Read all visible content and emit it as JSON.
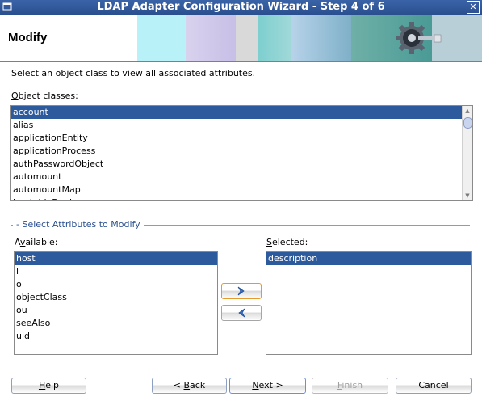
{
  "window": {
    "title": "LDAP Adapter Configuration Wizard - Step 4 of 6",
    "system_icon": "window-menu-icon",
    "close_icon": "close-icon",
    "close_glyph": "✕"
  },
  "header": {
    "title": "Modify",
    "banner_icon": "gear-plug-icon"
  },
  "instruction": "Select an object class to view all associated attributes.",
  "object_classes": {
    "label": "Object classes:",
    "items": [
      "account",
      "alias",
      "applicationEntity",
      "applicationProcess",
      "authPasswordObject",
      "automount",
      "automountMap",
      "bootableDevice"
    ],
    "selected": "account"
  },
  "attributes_group": {
    "title": "Select Attributes to Modify",
    "available_label": "Available:",
    "available": [
      "host",
      "l",
      "o",
      "objectClass",
      "ou",
      "seeAlso",
      "uid"
    ],
    "available_selected": "host",
    "selected_label": "Selected:",
    "selected": [
      "description"
    ],
    "selected_selected": "description",
    "add_icon": "move-right-icon",
    "remove_icon": "move-left-icon"
  },
  "buttons": {
    "help": "Help",
    "back": "< Back",
    "next": "Next >",
    "finish": "Finish",
    "cancel": "Cancel"
  },
  "colors": {
    "title_bar": "#2a4f8f",
    "selection": "#2d5a9c",
    "group_title": "#2a4f8f"
  }
}
